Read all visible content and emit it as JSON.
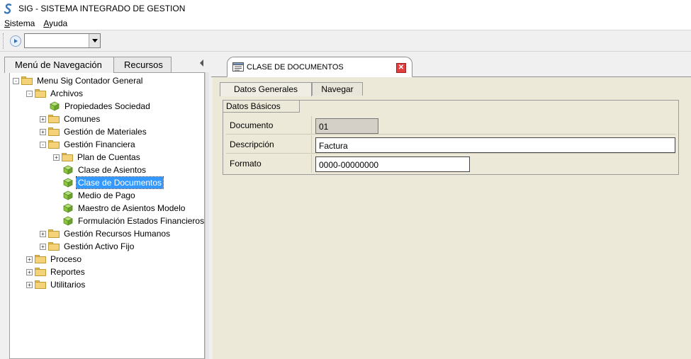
{
  "window": {
    "title": "SIG - SISTEMA INTEGRADO DE GESTION",
    "icon": "sig-logo-icon"
  },
  "menubar": {
    "items": [
      {
        "label": "Sistema",
        "accel": "S"
      },
      {
        "label": "Ayuda",
        "accel": "A"
      }
    ]
  },
  "toolbar": {
    "combo_value": ""
  },
  "left_panel": {
    "tabs": [
      {
        "label": "Menú de Navegación",
        "active": true
      },
      {
        "label": "Recursos",
        "active": false
      }
    ],
    "tree": [
      {
        "label": "Menu Sig  Contador General",
        "level": 0,
        "type": "folder",
        "expander": "-"
      },
      {
        "label": "Archivos",
        "level": 1,
        "type": "folder",
        "expander": "-"
      },
      {
        "label": "Propiedades Sociedad",
        "level": 2,
        "type": "leaf",
        "expander": ""
      },
      {
        "label": "Comunes",
        "level": 2,
        "type": "folder",
        "expander": "+"
      },
      {
        "label": "Gestión de Materiales",
        "level": 2,
        "type": "folder",
        "expander": "+"
      },
      {
        "label": "Gestión Financiera",
        "level": 2,
        "type": "folder",
        "expander": "-"
      },
      {
        "label": "Plan de Cuentas",
        "level": 3,
        "type": "folder",
        "expander": "+"
      },
      {
        "label": "Clase de Asientos",
        "level": 3,
        "type": "leaf",
        "expander": ""
      },
      {
        "label": "Clase de Documentos",
        "level": 3,
        "type": "leaf",
        "expander": "",
        "selected": true
      },
      {
        "label": "Medio de Pago",
        "level": 3,
        "type": "leaf",
        "expander": ""
      },
      {
        "label": "Maestro de Asientos Modelo",
        "level": 3,
        "type": "leaf",
        "expander": ""
      },
      {
        "label": "Formulación Estados Financieros",
        "level": 3,
        "type": "leaf",
        "expander": ""
      },
      {
        "label": "Gestión Recursos Humanos",
        "level": 2,
        "type": "folder",
        "expander": "+"
      },
      {
        "label": "Gestión Activo Fijo",
        "level": 2,
        "type": "folder",
        "expander": "+"
      },
      {
        "label": "Proceso",
        "level": 1,
        "type": "folder",
        "expander": "+"
      },
      {
        "label": "Reportes",
        "level": 1,
        "type": "folder",
        "expander": "+"
      },
      {
        "label": "Utilitarios",
        "level": 1,
        "type": "folder",
        "expander": "+"
      }
    ]
  },
  "document": {
    "tab_label": "CLASE DE DOCUMENTOS",
    "close_label": "✕",
    "subtabs": [
      {
        "label": "Datos Generales",
        "active": true
      },
      {
        "label": "Navegar",
        "active": false
      }
    ],
    "group_title": "Datos Básicos",
    "fields": [
      {
        "label": "Documento",
        "value": "01",
        "readonly": true
      },
      {
        "label": "Descripción",
        "value": "Factura",
        "readonly": false
      },
      {
        "label": "Formato",
        "value": "0000-00000000",
        "readonly": false
      }
    ]
  },
  "colors": {
    "selection": "#3399ff",
    "folder": "#f3d27a",
    "cube": "#8cc63f",
    "close": "#e04040"
  }
}
